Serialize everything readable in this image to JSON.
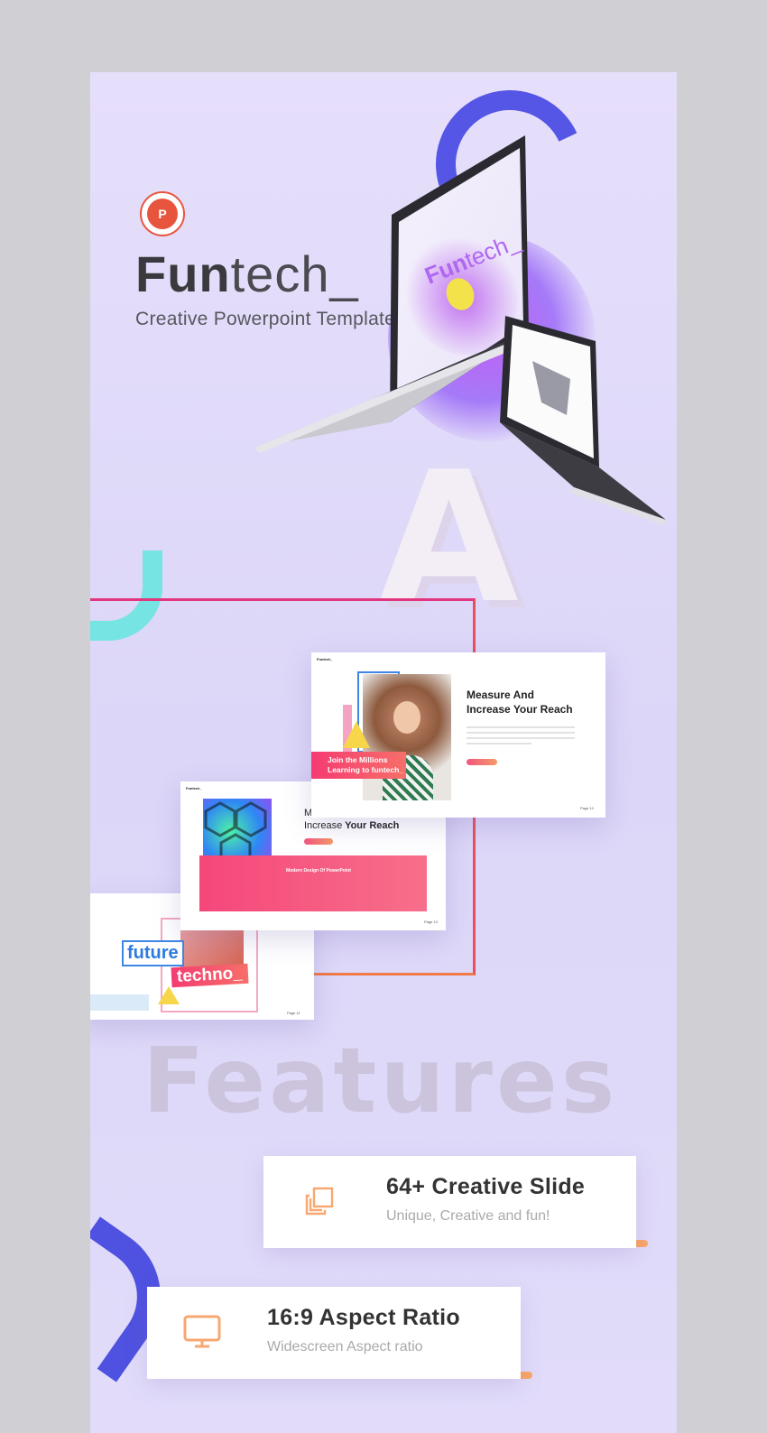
{
  "brand": {
    "title_bold": "Fun",
    "title_light": "tech_",
    "subtitle": "Creative Powerpoint Template",
    "logo_letter": "P",
    "accent": "#e8553e"
  },
  "laptop_screen": {
    "title_bold": "Fun",
    "title_light": "tech_"
  },
  "slides": {
    "slide_a": {
      "logo": "Funtech_",
      "heading_line1": "Measure And",
      "heading_line2": "Increase Your Reach",
      "banner_line1": "Join the Millions",
      "banner_line2": "Learning to funtech_",
      "page": "Page 12"
    },
    "slide_b": {
      "logo": "Funtech_",
      "heading_line1": "Me",
      "heading_line2_light": "Increase",
      "heading_line2_bold": "Your Reach",
      "box_title": "Modern Design Of PowerPoint",
      "page": "Page 13"
    },
    "slide_c": {
      "word1": "future",
      "word2": "techno_",
      "page": "Page 11"
    }
  },
  "features_heading": "Features",
  "features": [
    {
      "icon": "copy-icon",
      "title": "64+ Creative Slide",
      "subtitle": "Unique, Creative and fun!"
    },
    {
      "icon": "monitor-icon",
      "title": "16:9 Aspect Ratio",
      "subtitle": "Widescreen Aspect ratio"
    }
  ],
  "colors": {
    "background": "#e2dcfa",
    "frame_border": "#e2357e",
    "icon_orange": "#f7a770",
    "bar_gradient_start": "#f2598e",
    "bar_gradient_end": "#f9a866"
  }
}
